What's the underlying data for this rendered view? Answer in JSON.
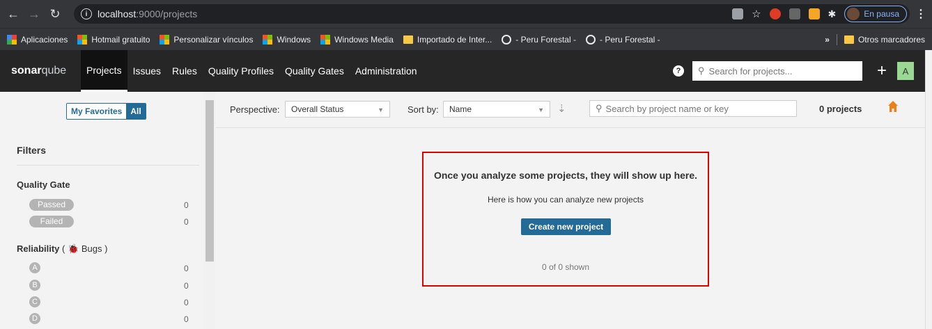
{
  "browser": {
    "url_host": "localhost",
    "url_rest": ":9000/projects",
    "profile_status": "En pausa",
    "bookmarks": [
      {
        "label": "Aplicaciones",
        "icon": "apps-grid-icon"
      },
      {
        "label": "Hotmail gratuito",
        "icon": "microsoft-icon"
      },
      {
        "label": "Personalizar vínculos",
        "icon": "microsoft-icon"
      },
      {
        "label": "Windows",
        "icon": "microsoft-icon"
      },
      {
        "label": "Windows Media",
        "icon": "microsoft-icon"
      },
      {
        "label": "Importado de Inter...",
        "icon": "folder-icon"
      },
      {
        "label": "- Peru Forestal -",
        "icon": "globe-icon"
      },
      {
        "label": "- Peru Forestal -",
        "icon": "globe-icon"
      }
    ],
    "more_bookmarks": "»",
    "other_bookmarks": "Otros marcadores"
  },
  "sonar": {
    "logo_bold": "sonar",
    "logo_rest": "qube",
    "nav": [
      "Projects",
      "Issues",
      "Rules",
      "Quality Profiles",
      "Quality Gates",
      "Administration"
    ],
    "search_placeholder": "Search for projects...",
    "plus": "+",
    "avatar": "A",
    "help": "?"
  },
  "sidebar": {
    "my_favorites": "My Favorites",
    "all": "All",
    "filters_title": "Filters",
    "quality_gate": {
      "title": "Quality Gate",
      "items": [
        {
          "label": "Passed",
          "count": "0"
        },
        {
          "label": "Failed",
          "count": "0"
        }
      ]
    },
    "reliability": {
      "title": "Reliability",
      "sub_open": "(",
      "sub_label": "Bugs",
      "sub_close": ")",
      "items": [
        {
          "label": "A",
          "count": "0"
        },
        {
          "label": "B",
          "count": "0"
        },
        {
          "label": "C",
          "count": "0"
        },
        {
          "label": "D",
          "count": "0"
        }
      ]
    }
  },
  "toolbar": {
    "perspective_label": "Perspective:",
    "perspective_value": "Overall Status",
    "sort_label": "Sort by:",
    "sort_value": "Name",
    "search_placeholder": "Search by project name or key",
    "project_count": "0 projects"
  },
  "empty_state": {
    "title": "Once you analyze some projects, they will show up here.",
    "subtitle": "Here is how you can analyze new projects",
    "button": "Create new project",
    "shown": "0 of 0 shown"
  },
  "colors": {
    "accent": "#236a97",
    "highlight_border": "#e00000",
    "nav_bg": "#262626"
  }
}
